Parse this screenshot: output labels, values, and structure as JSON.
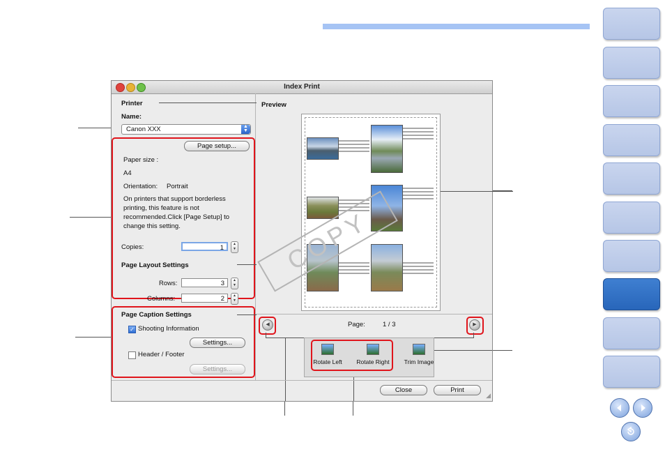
{
  "window": {
    "title": "Index Print"
  },
  "printer": {
    "section_label": "Printer",
    "name_label": "Name:",
    "selected": "Canon XXX",
    "page_setup_button": "Page setup..."
  },
  "paper": {
    "size_label": "Paper size :",
    "size_value": "A4",
    "orientation_label": "Orientation:",
    "orientation_value": "Portrait",
    "borderless_note_1": "On printers that support borderless",
    "borderless_note_2": "printing, this feature is not",
    "borderless_note_3": "recommended.Click [Page Setup] to",
    "borderless_note_4": "change this setting."
  },
  "copies": {
    "label": "Copies:",
    "value": "1"
  },
  "layout": {
    "section_label": "Page Layout Settings",
    "rows_label": "Rows:",
    "rows_value": "3",
    "columns_label": "Columns:",
    "columns_value": "2"
  },
  "caption": {
    "section_label": "Page Caption Settings",
    "shooting_info_label": "Shooting Information",
    "shooting_info_checked": true,
    "shooting_settings_button": "Settings...",
    "header_footer_label": "Header / Footer",
    "header_footer_checked": false,
    "header_settings_button": "Settings..."
  },
  "preview": {
    "label": "Preview",
    "page_label": "Page:",
    "page_value": "1 / 3",
    "watermark": "COPY"
  },
  "tools": {
    "rotate_left": "Rotate Left",
    "rotate_right": "Rotate Right",
    "trim_image": "Trim Image"
  },
  "footer_buttons": {
    "close": "Close",
    "print": "Print"
  },
  "icons": {
    "traffic_lights": [
      "close-light-icon",
      "minimize-light-icon",
      "zoom-light-icon"
    ],
    "nav": [
      "prev-page-icon",
      "next-page-icon",
      "return-icon"
    ]
  },
  "colors": {
    "accent_bar": "#a6c4f4",
    "highlight_red": "#e0141b",
    "active_tab": "#2866ba",
    "tab": "#b6c6e6"
  }
}
